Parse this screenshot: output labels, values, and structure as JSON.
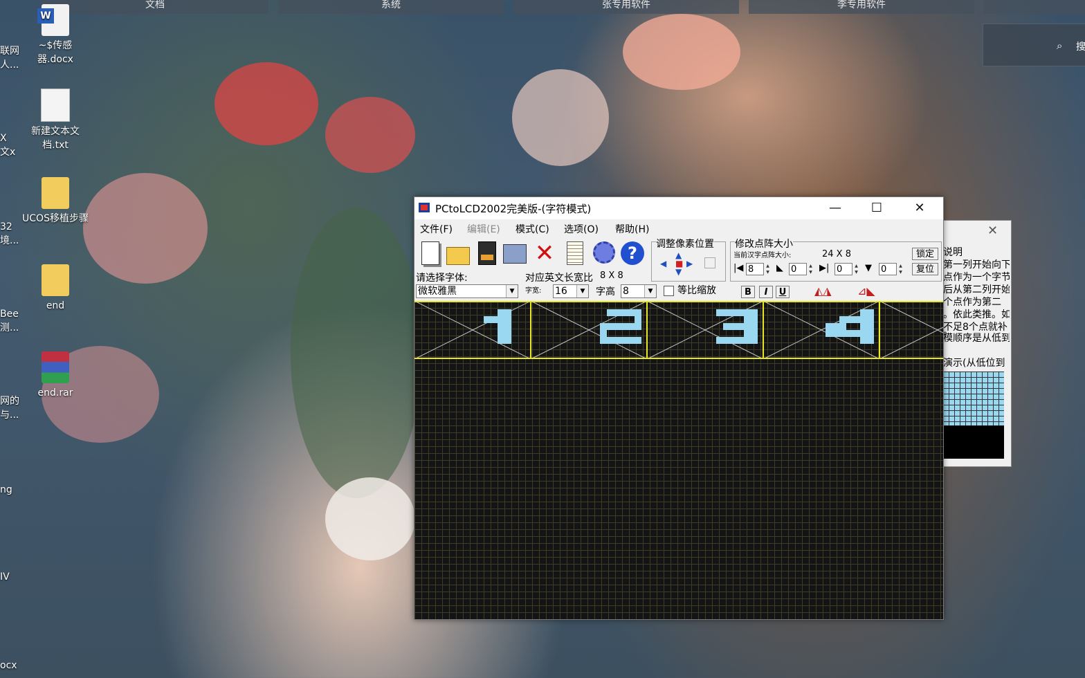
{
  "taskbar": {
    "tabs": [
      "文档",
      "系统",
      "张专用软件",
      "李专用软件"
    ]
  },
  "search": {
    "label": "搜"
  },
  "desktop_icons": [
    {
      "label": "~$传感器.docx",
      "icon": "word-doc-icon"
    },
    {
      "label": "新建文本文档.txt",
      "icon": "text-file-icon"
    },
    {
      "label": "UCOS移植步骤",
      "icon": "folder-icon"
    },
    {
      "label": "end",
      "icon": "folder-icon"
    },
    {
      "label": "end.rar",
      "icon": "winrar-archive-icon"
    }
  ],
  "edge_labels": [
    "联网人...",
    "X 文x",
    "32境...",
    "Bee测...",
    "网的与...",
    "ng",
    "IV",
    "ocx"
  ],
  "window": {
    "title": "PCtoLCD2002完美版-(字符模式)",
    "controls": {
      "minimize": "—",
      "maximize": "☐",
      "close": "✕"
    },
    "menu": [
      {
        "label": "文件(F)",
        "enabled": true
      },
      {
        "label": "编辑(E)",
        "enabled": false
      },
      {
        "label": "模式(C)",
        "enabled": true
      },
      {
        "label": "选项(O)",
        "enabled": true
      },
      {
        "label": "帮助(H)",
        "enabled": true
      }
    ],
    "toolbar_icons": [
      "new-icon",
      "open-icon",
      "save-icon",
      "generate-icon",
      "delete-icon",
      "notes-icon",
      "settings-gear-icon",
      "help-icon"
    ],
    "adjust_pixel_label": "调整像素位置",
    "matrix_size": {
      "label": "修改点阵大小",
      "current_label": "当前汉字点阵大小:",
      "current_value": "24 X 8",
      "values": [
        "8",
        "0",
        "0",
        "0"
      ],
      "lock_label": "锁定",
      "reset_label": "复位"
    },
    "font": {
      "select_label": "请选择字体:",
      "ratio_label": "对应英文长宽比",
      "ratio_value": "8 X 8",
      "name": "微软雅黑",
      "width_label": "字宽:",
      "width_value": "16",
      "height_label": "字高",
      "height_value": "8",
      "proportional_label": "等比缩放",
      "bold": "B",
      "italic": "I",
      "underline": "U"
    },
    "glyphs": [
      "1",
      "2",
      "3",
      "4"
    ],
    "colors": {
      "pixel_on": "#9ad8f2",
      "grid_line": "#3d3d2a",
      "selection": "#e8e820"
    }
  },
  "help_window": {
    "lines": [
      "说明",
      "第一列开始向下",
      "点作为一个字节",
      "后从第二列开始",
      "个点作为第二",
      "。依此类推。如",
      "不足8个点就补",
      "。",
      "模顺序是从低到"
    ],
    "demo_label": "演示(从低位到"
  }
}
